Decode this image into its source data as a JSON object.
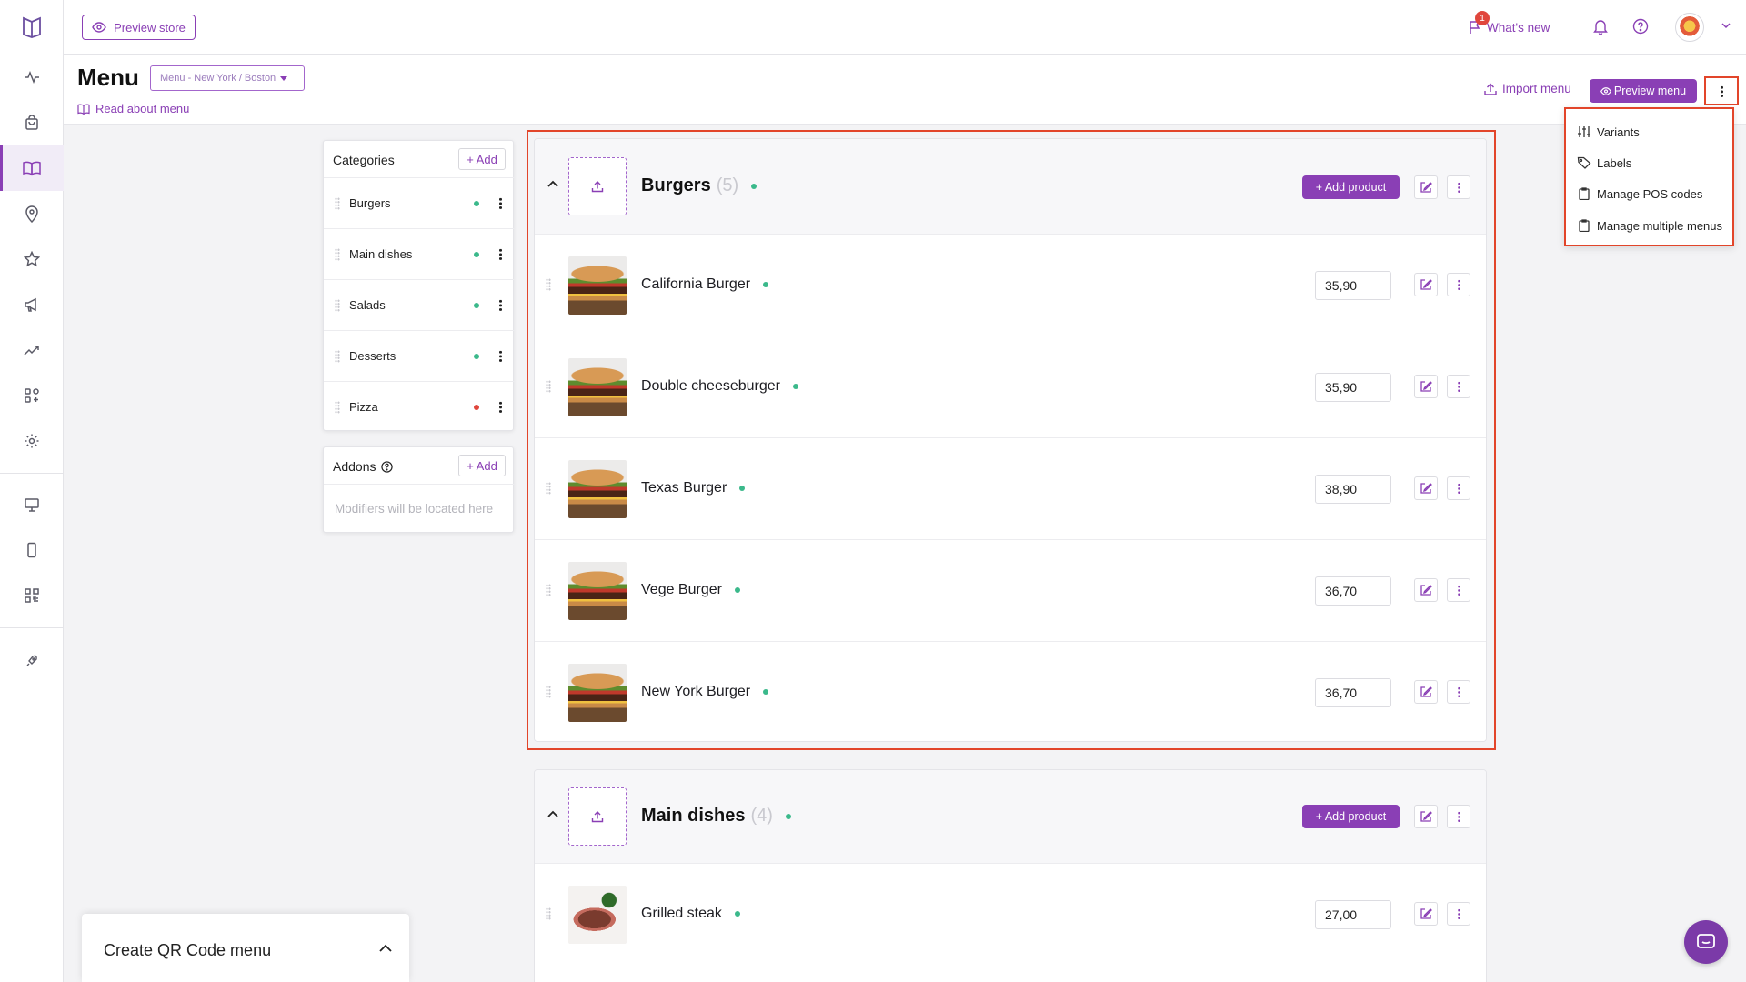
{
  "topbar": {
    "preview_store_label": "Preview store",
    "whats_new_label": "What's new",
    "whats_new_badge": "1"
  },
  "page": {
    "title": "Menu",
    "menu_select_value": "Menu - New York / Boston",
    "read_about_label": "Read about menu",
    "import_menu_label": "Import menu",
    "preview_menu_label": "Preview menu"
  },
  "more_menu": {
    "items": [
      {
        "label": "Variants",
        "icon": "sliders-icon"
      },
      {
        "label": "Labels",
        "icon": "tag-icon"
      },
      {
        "label": "Manage POS codes",
        "icon": "clipboard-icon"
      },
      {
        "label": "Manage multiple menus",
        "icon": "clipboard-icon"
      }
    ]
  },
  "categories_panel": {
    "title": "Categories",
    "add_label": "+ Add",
    "items": [
      {
        "label": "Burgers",
        "status_color": "#3bb98b"
      },
      {
        "label": "Main dishes",
        "status_color": "#3bb98b"
      },
      {
        "label": "Salads",
        "status_color": "#3bb98b"
      },
      {
        "label": "Desserts",
        "status_color": "#3bb98b"
      },
      {
        "label": "Pizza",
        "status_color": "#e0463c"
      }
    ]
  },
  "addons_panel": {
    "title": "Addons",
    "add_label": "+ Add",
    "placeholder": "Modifiers will be located here"
  },
  "categories": [
    {
      "name": "Burgers",
      "count": "(5)",
      "add_product_label": "+  Add product",
      "products": [
        {
          "name": "California Burger",
          "price": "35,90"
        },
        {
          "name": "Double cheeseburger",
          "price": "35,90"
        },
        {
          "name": "Texas Burger",
          "price": "38,90"
        },
        {
          "name": "Vege Burger",
          "price": "36,70"
        },
        {
          "name": "New York Burger",
          "price": "36,70"
        }
      ]
    },
    {
      "name": "Main dishes",
      "count": "(4)",
      "add_product_label": "+  Add product",
      "products": [
        {
          "name": "Grilled steak",
          "price": "27,00"
        }
      ]
    }
  ],
  "qr_panel": {
    "title": "Create QR Code menu"
  },
  "colors": {
    "accent": "#8a3fb5",
    "status_active": "#3bb98b",
    "status_inactive": "#e0463c",
    "highlight": "#e2452a"
  }
}
